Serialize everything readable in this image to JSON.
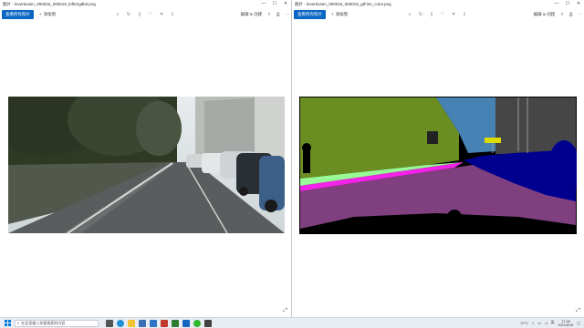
{
  "left_window": {
    "title": "图片 - leverkusen_000016_000019_leftImg8bit.png",
    "primary_button": "查看所有照片",
    "add_button": "添加到",
    "edit_label": "编辑 & 创建",
    "image_desc": "street scene photo"
  },
  "right_window": {
    "title": "图片 - leverkusen_000016_000019_gtFine_color.png",
    "primary_button": "查看所有照片",
    "add_button": "添加到",
    "edit_label": "编辑 & 创建",
    "image_desc": "semantic segmentation label map"
  },
  "window_controls": {
    "minimize": "—",
    "maximize": "☐",
    "close": "✕"
  },
  "toolbar_icons": [
    "zoom-in-icon",
    "rotate-icon",
    "delete-icon",
    "favorite-icon",
    "crop-icon",
    "share-icon"
  ],
  "taskbar": {
    "search_placeholder": "在这里输入你要搜索的内容",
    "weather": "27°C",
    "ime": "英",
    "time": "17:48",
    "date": "2021/8/16"
  },
  "colors": {
    "accent": "#0a66c2",
    "seg_vegetation": "#6b8e23",
    "seg_road": "#804080",
    "seg_sky": "#4682b4",
    "seg_car": "#00008e",
    "seg_building": "#464646",
    "seg_sidewalk": "#f423e8",
    "seg_terrain": "#98fb98",
    "seg_sign": "#dcdc00"
  }
}
